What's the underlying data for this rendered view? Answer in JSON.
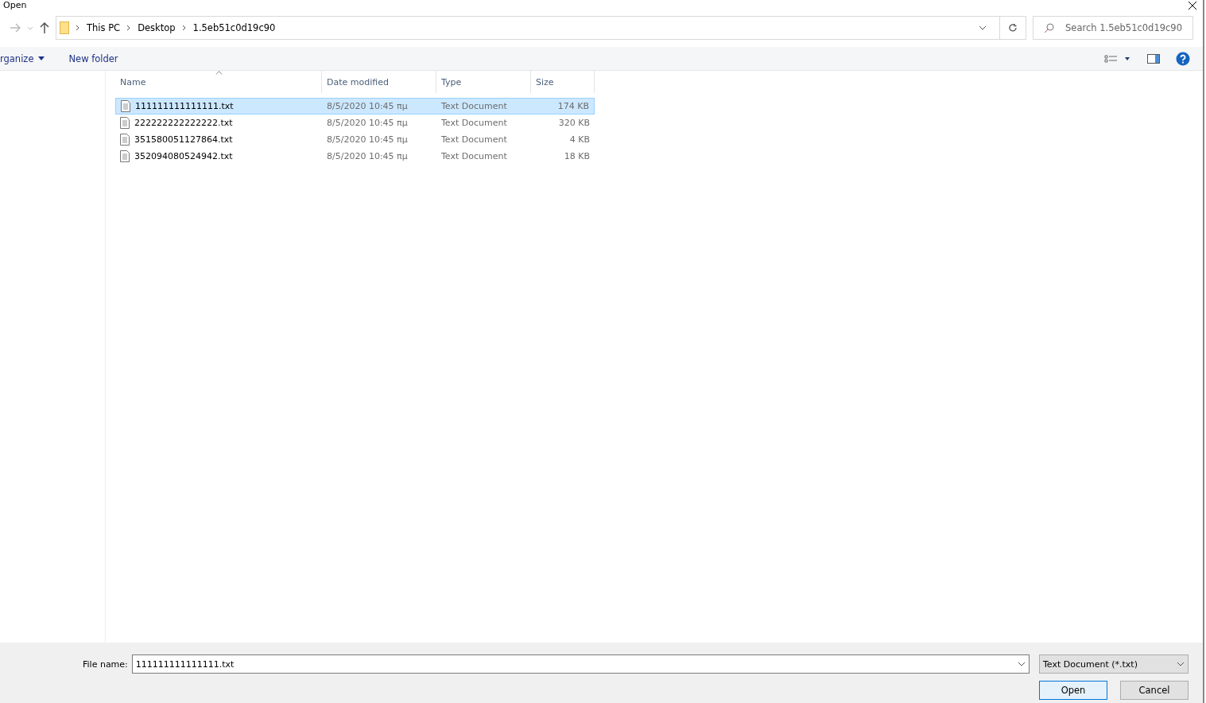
{
  "window": {
    "title": "Open"
  },
  "address_bar": {
    "crumbs": [
      "This PC",
      "Desktop",
      "1.5eb51c0d19c90"
    ]
  },
  "search": {
    "placeholder": "Search 1.5eb51c0d19c90"
  },
  "toolbar": {
    "organize": "rganize",
    "new_folder": "New folder"
  },
  "table": {
    "columns": [
      {
        "label": "Name",
        "sorted": true
      },
      {
        "label": "Date modified",
        "sorted": false
      },
      {
        "label": "Type",
        "sorted": false
      },
      {
        "label": "Size",
        "sorted": false
      }
    ],
    "rows": [
      {
        "name": "111111111111111.txt",
        "date": "8/5/2020 10:45 πμ",
        "type": "Text Document",
        "size": "174 KB",
        "selected": true
      },
      {
        "name": "222222222222222.txt",
        "date": "8/5/2020 10:45 πμ",
        "type": "Text Document",
        "size": "320 KB",
        "selected": false
      },
      {
        "name": "351580051127864.txt",
        "date": "8/5/2020 10:45 πμ",
        "type": "Text Document",
        "size": "4 KB",
        "selected": false
      },
      {
        "name": "352094080524942.txt",
        "date": "8/5/2020 10:45 πμ",
        "type": "Text Document",
        "size": "18 KB",
        "selected": false
      }
    ]
  },
  "footer": {
    "file_name_label": "File name:",
    "file_name": "111111111111111.txt",
    "file_type": "Text Document (*.txt)",
    "buttons": [
      {
        "label": "Open",
        "kind": "primary"
      },
      {
        "label": "Cancel",
        "kind": "normal"
      }
    ]
  }
}
